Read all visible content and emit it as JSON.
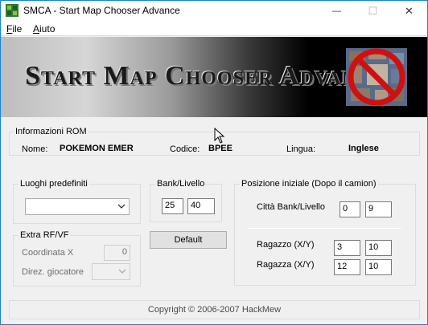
{
  "window": {
    "title": "SMCA - Start Map Chooser Advance",
    "minimize_glyph": "—",
    "maximize_glyph": "☐",
    "close_glyph": "✕"
  },
  "menu": {
    "file_first": "F",
    "file_rest": "ile",
    "aiuto_first": "A",
    "aiuto_rest": "iuto"
  },
  "banner": {
    "title": "Start Map Chooser Advance"
  },
  "rom_info": {
    "group_label": "Informazioni ROM",
    "name_label": "Nome:",
    "name_value": "POKEMON EMER",
    "code_label": "Codice:",
    "code_value": "BPEE",
    "language_label": "Lingua:",
    "language_value": "Inglese"
  },
  "preset_places": {
    "group_label": "Luoghi predefiniti",
    "selected": ""
  },
  "bank_level": {
    "group_label": "Bank/Livello",
    "bank": "25",
    "level": "40",
    "default_button": "Default"
  },
  "extra": {
    "group_label": "Extra RF/VF",
    "coord_label": "Coordinata X",
    "coord_value": "0",
    "direction_label": "Direz. giocatore",
    "direction_value": ""
  },
  "start_position": {
    "group_label": "Posizione iniziale (Dopo il camion)",
    "city_label": "Città Bank/Livello",
    "city_bank": "0",
    "city_level": "9",
    "boy_label": "Ragazzo (X/Y)",
    "boy_x": "3",
    "boy_y": "10",
    "girl_label": "Ragazza (X/Y)",
    "girl_x": "12",
    "girl_y": "10"
  },
  "footer": {
    "copyright": "Copyright © 2006-2007 HackMew"
  },
  "colors": {
    "window_border": "#1883d7",
    "dialog_bg": "#f0f0f0",
    "no_sign_red": "#d01010"
  }
}
